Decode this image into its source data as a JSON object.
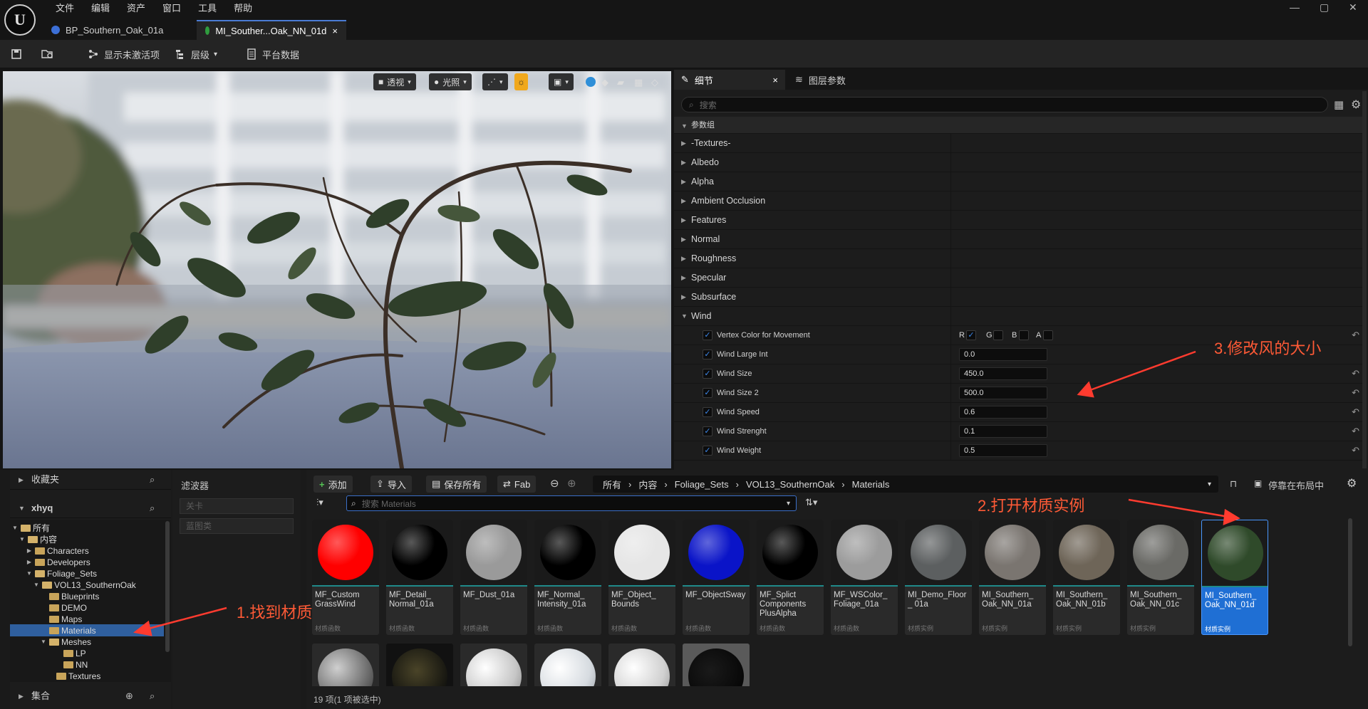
{
  "menu": [
    "文件",
    "编辑",
    "资产",
    "窗口",
    "工具",
    "帮助"
  ],
  "logo": "U",
  "window_controls": {
    "minimize": "—",
    "maximize": "▢",
    "close": "✕"
  },
  "tabs": [
    {
      "label": "BP_Southern_Oak_01a"
    },
    {
      "label": "MI_Souther...Oak_NN_01d",
      "close": "×"
    }
  ],
  "toolbar": {
    "show_inactive": "显示未激活项",
    "hierarchy": "层级",
    "platform": "平台数据"
  },
  "viewport": {
    "perspective": "透视",
    "lighting": "光照"
  },
  "details": {
    "tab_details": "细节",
    "tab_close": "×",
    "tab_layers": "图层参数",
    "search_placeholder": "搜索",
    "group_header": "参数组",
    "groups": [
      "-Textures-",
      "Albedo",
      "Alpha",
      "Ambient Occlusion",
      "Features",
      "Normal",
      "Roughness",
      "Specular",
      "Subsurface",
      "Wind"
    ],
    "vertex_color": {
      "label": "Vertex Color for Movement",
      "channels": [
        "R",
        "G",
        "B",
        "A"
      ],
      "checked": [
        true,
        false,
        false,
        false
      ]
    },
    "wind_params": [
      {
        "label": "Wind Large Int",
        "value": "0.0",
        "reset": false
      },
      {
        "label": "Wind Size",
        "value": "450.0",
        "reset": true
      },
      {
        "label": "Wind Size 2",
        "value": "500.0",
        "reset": true
      },
      {
        "label": "Wind Speed",
        "value": "0.6",
        "reset": true
      },
      {
        "label": "Wind Strenght",
        "value": "0.1",
        "reset": true
      },
      {
        "label": "Wind Weight",
        "value": "0.5",
        "reset": true
      }
    ]
  },
  "sources": {
    "favorites": "收藏夹",
    "project": "xhyq",
    "collections": "集合",
    "tree": {
      "all": "所有",
      "content": "内容",
      "characters": "Characters",
      "developers": "Developers",
      "foliage_sets": "Foliage_Sets",
      "vol13": "VOL13_SouthernOak",
      "blueprints": "Blueprints",
      "demo": "DEMO",
      "maps": "Maps",
      "materials": "Materials",
      "meshes": "Meshes",
      "lp": "LP",
      "nn": "NN",
      "textures": "Textures"
    }
  },
  "filters": {
    "title": "滤波器",
    "items": [
      "关卡",
      "蓝图类"
    ]
  },
  "content_browser": {
    "add": "添加",
    "import": "导入",
    "save_all": "保存所有",
    "fab": "Fab",
    "breadcrumb": [
      "所有",
      "内容",
      "Foliage_Sets",
      "VOL13_SouthernOak",
      "Materials"
    ],
    "dock": "停靠在布局中",
    "search_placeholder": "搜索 Materials",
    "status": "19 项(1 项被选中)",
    "assets": [
      {
        "name": "MF_Custom GrassWind",
        "type": "材质函数",
        "color": "#ff0000"
      },
      {
        "name": "MF_Detail_ Normal_01a",
        "type": "材质函数",
        "color": "#000000"
      },
      {
        "name": "MF_Dust_01a",
        "type": "材质函数",
        "color": "#9a9a9a"
      },
      {
        "name": "MF_Normal_ Intensity_01a",
        "type": "材质函数",
        "color": "#000000"
      },
      {
        "name": "MF_Object_ Bounds",
        "type": "材质函数",
        "color": "#e6e6e6"
      },
      {
        "name": "MF_ObjectSway",
        "type": "材质函数",
        "color": "#0a14c8"
      },
      {
        "name": "MF_Splict Components PlusAlpha",
        "type": "材质函数",
        "color": "#000000"
      },
      {
        "name": "MF_WSColor_ Foliage_01a",
        "type": "材质函数",
        "color": "#9c9c9c"
      },
      {
        "name": "MI_Demo_Floor_ 01a",
        "type": "材质实例",
        "color": "#5c5f60"
      },
      {
        "name": "MI_Southern_ Oak_NN_01a",
        "type": "材质实例",
        "color": "#7a7570"
      },
      {
        "name": "MI_Southern_ Oak_NN_01b",
        "type": "材质实例",
        "color": "#6e6558"
      },
      {
        "name": "MI_Southern_ Oak_NN_01c",
        "type": "材质实例",
        "color": "#6a6a66"
      },
      {
        "name": "MI_Southern_ Oak_NN_01d",
        "type": "材质实例",
        "color": "#2f4a2a"
      }
    ]
  },
  "annotations": {
    "step1": "1.找到材质",
    "step2": "2.打开材质实例",
    "step3": "3.修改风的大小"
  }
}
